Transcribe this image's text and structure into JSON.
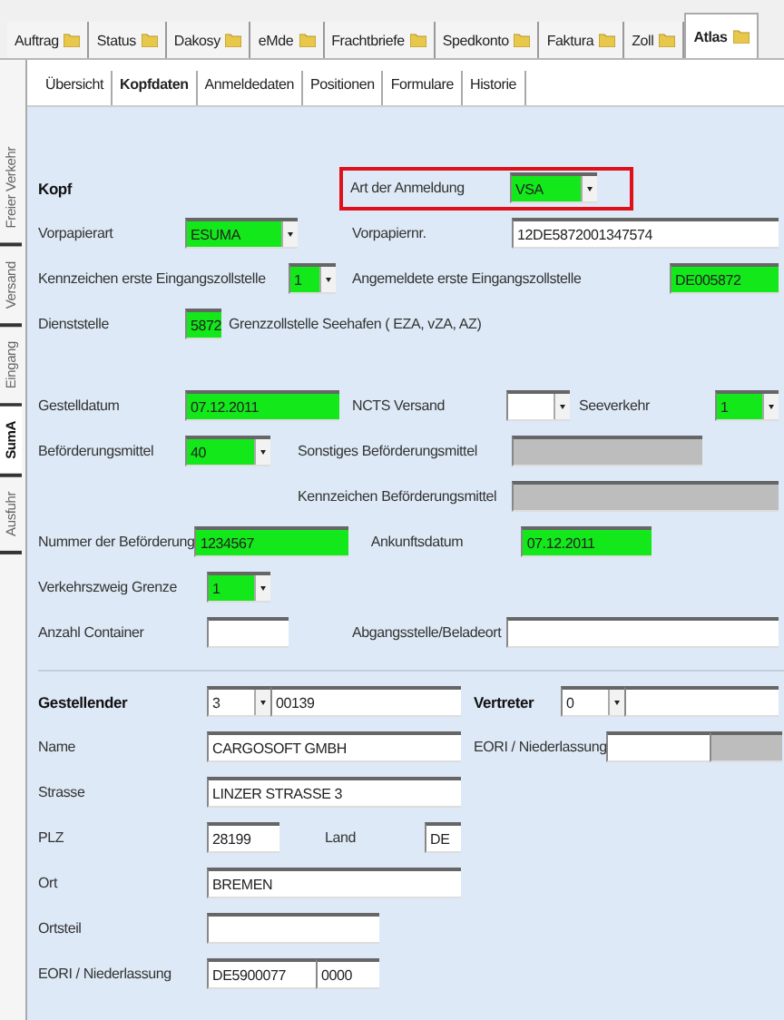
{
  "top_tabs": [
    {
      "label": "Auftrag",
      "selected": false
    },
    {
      "label": "Status",
      "selected": false
    },
    {
      "label": "Dakosy",
      "selected": false
    },
    {
      "label": "eMde",
      "selected": false
    },
    {
      "label": "Frachtbriefe",
      "selected": false
    },
    {
      "label": "Spedkonto",
      "selected": false
    },
    {
      "label": "Faktura",
      "selected": false
    },
    {
      "label": "Zoll",
      "selected": false
    },
    {
      "label": "Atlas",
      "selected": true
    }
  ],
  "sub_tabs": [
    {
      "label": "Übersicht",
      "selected": false
    },
    {
      "label": "Kopfdaten",
      "selected": true
    },
    {
      "label": "Anmeldedaten",
      "selected": false
    },
    {
      "label": "Positionen",
      "selected": false
    },
    {
      "label": "Formulare",
      "selected": false
    },
    {
      "label": "Historie",
      "selected": false
    }
  ],
  "side_tabs": [
    {
      "label": "Freier Verkehr",
      "selected": false
    },
    {
      "label": "Versand",
      "selected": false
    },
    {
      "label": "Eingang",
      "selected": false
    },
    {
      "label": "SumA",
      "selected": true
    },
    {
      "label": "Ausfuhr",
      "selected": false
    }
  ],
  "rows": [
    [
      {
        "kind": "heading",
        "text": "Kopf"
      },
      {
        "kind": "frame",
        "items": [
          {
            "kind": "label",
            "text": "Art der Anmeldung"
          },
          {
            "kind": "select",
            "value": "VSA",
            "highlighted": true,
            "disabled": false
          }
        ]
      }
    ],
    [
      {
        "kind": "label",
        "text": "Vorpapierart"
      },
      {
        "kind": "select",
        "value": "ESUMA",
        "highlighted": true,
        "disabled": false
      },
      {
        "kind": "label",
        "text": "Vorpapiernr."
      },
      {
        "kind": "input",
        "value": "12DE5872001347574",
        "highlighted": false,
        "disabled": false
      }
    ],
    [
      {
        "kind": "label",
        "text": "Kennzeichen erste Eingangszollstelle"
      },
      {
        "kind": "select",
        "value": "1",
        "highlighted": true,
        "disabled": false
      },
      {
        "kind": "label",
        "text": "Angemeldete erste Eingangszollstelle"
      },
      {
        "kind": "input",
        "value": "DE005872",
        "highlighted": true,
        "disabled": false
      }
    ],
    [
      {
        "kind": "label",
        "text": "Dienststelle"
      },
      {
        "kind": "input",
        "value": "5872",
        "highlighted": true,
        "disabled": false
      },
      {
        "kind": "label",
        "text": "Grenzzollstelle Seehafen ( EZA, vZA, AZ)"
      }
    ],
    [
      {
        "kind": "label",
        "text": "Gestelldatum"
      },
      {
        "kind": "input",
        "value": "07.12.2011",
        "highlighted": true,
        "disabled": false
      },
      {
        "kind": "label",
        "text": "NCTS Versand"
      },
      {
        "kind": "select",
        "highlighted": false,
        "disabled": false
      },
      {
        "kind": "label",
        "text": "Seeverkehr"
      },
      {
        "kind": "select",
        "value": "1",
        "highlighted": true,
        "disabled": false
      }
    ],
    [
      {
        "kind": "label",
        "text": "Beförderungsmittel"
      },
      {
        "kind": "select",
        "value": "40",
        "highlighted": true,
        "disabled": false
      },
      {
        "kind": "label",
        "text": "Sonstiges Beförderungsmittel"
      },
      {
        "kind": "input",
        "highlighted": false,
        "disabled": true
      }
    ],
    [
      {
        "kind": "label",
        "text": "Kennzeichen Beförderungsmittel"
      },
      {
        "kind": "input",
        "highlighted": false,
        "disabled": true
      }
    ],
    [
      {
        "kind": "label",
        "text": "Nummer der Beförderung"
      },
      {
        "kind": "input",
        "value": "1234567",
        "highlighted": true,
        "disabled": false
      },
      {
        "kind": "label",
        "text": "Ankunftsdatum"
      },
      {
        "kind": "input",
        "value": "07.12.2011",
        "highlighted": true,
        "disabled": false
      }
    ],
    [
      {
        "kind": "label",
        "text": "Verkehrszweig Grenze"
      },
      {
        "kind": "select",
        "value": "1",
        "highlighted": true,
        "disabled": false
      }
    ],
    [
      {
        "kind": "label",
        "text": "Anzahl Container"
      },
      {
        "kind": "input",
        "highlighted": false,
        "disabled": false
      },
      {
        "kind": "label",
        "text": "Abgangsstelle/Beladeort"
      },
      {
        "kind": "input",
        "highlighted": false,
        "disabled": false
      }
    ],
    [
      {
        "kind": "heading",
        "text": "Gestellender"
      },
      {
        "kind": "select",
        "value": "3",
        "highlighted": false,
        "disabled": false
      },
      {
        "kind": "input",
        "value": "00139",
        "highlighted": false,
        "disabled": false
      },
      {
        "kind": "heading",
        "text": "Vertreter"
      },
      {
        "kind": "select",
        "value": "0",
        "highlighted": false,
        "disabled": false
      },
      {
        "kind": "input",
        "highlighted": false,
        "disabled": false
      }
    ],
    [
      {
        "kind": "label",
        "text": "Name"
      },
      {
        "kind": "input",
        "value": "CARGOSOFT GMBH",
        "highlighted": false,
        "disabled": false
      },
      {
        "kind": "label",
        "text": "EORI / Niederlassung"
      },
      {
        "kind": "input",
        "highlighted": false,
        "disabled": false
      },
      {
        "kind": "input",
        "highlighted": false,
        "disabled": true
      }
    ],
    [
      {
        "kind": "label",
        "text": "Strasse"
      },
      {
        "kind": "input",
        "value": "LINZER STRASSE 3",
        "highlighted": false,
        "disabled": false
      }
    ],
    [
      {
        "kind": "label",
        "text": "PLZ"
      },
      {
        "kind": "input",
        "value": "28199",
        "highlighted": false,
        "disabled": false
      },
      {
        "kind": "label",
        "text": "Land"
      },
      {
        "kind": "input",
        "value": "DE",
        "highlighted": false,
        "disabled": false
      }
    ],
    [
      {
        "kind": "label",
        "text": "Ort"
      },
      {
        "kind": "input",
        "value": "BREMEN",
        "highlighted": false,
        "disabled": false
      }
    ],
    [
      {
        "kind": "label",
        "text": "Ortsteil"
      },
      {
        "kind": "input",
        "highlighted": false,
        "disabled": false
      }
    ],
    [
      {
        "kind": "label",
        "text": "EORI / Niederlassung"
      },
      {
        "kind": "input",
        "value": "DE5900077",
        "highlighted": false,
        "disabled": false
      },
      {
        "kind": "input",
        "value": "0000",
        "highlighted": false,
        "disabled": false
      }
    ]
  ]
}
